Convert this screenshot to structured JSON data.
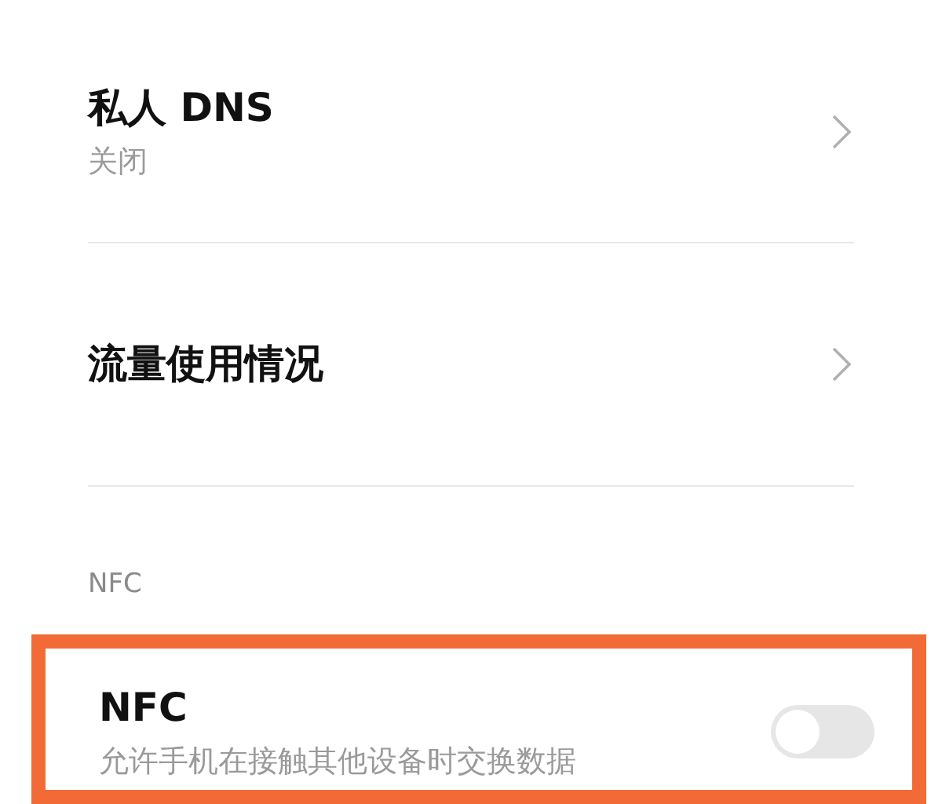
{
  "items": [
    {
      "kind": "link",
      "title": "私人 DNS",
      "subtitle": "关闭"
    },
    {
      "kind": "link",
      "title": "流量使用情况"
    }
  ],
  "section": {
    "header": "NFC",
    "items": [
      {
        "kind": "toggle",
        "title": "NFC",
        "subtitle": "允许手机在接触其他设备时交换数据",
        "on": false,
        "highlighted": true
      }
    ]
  }
}
